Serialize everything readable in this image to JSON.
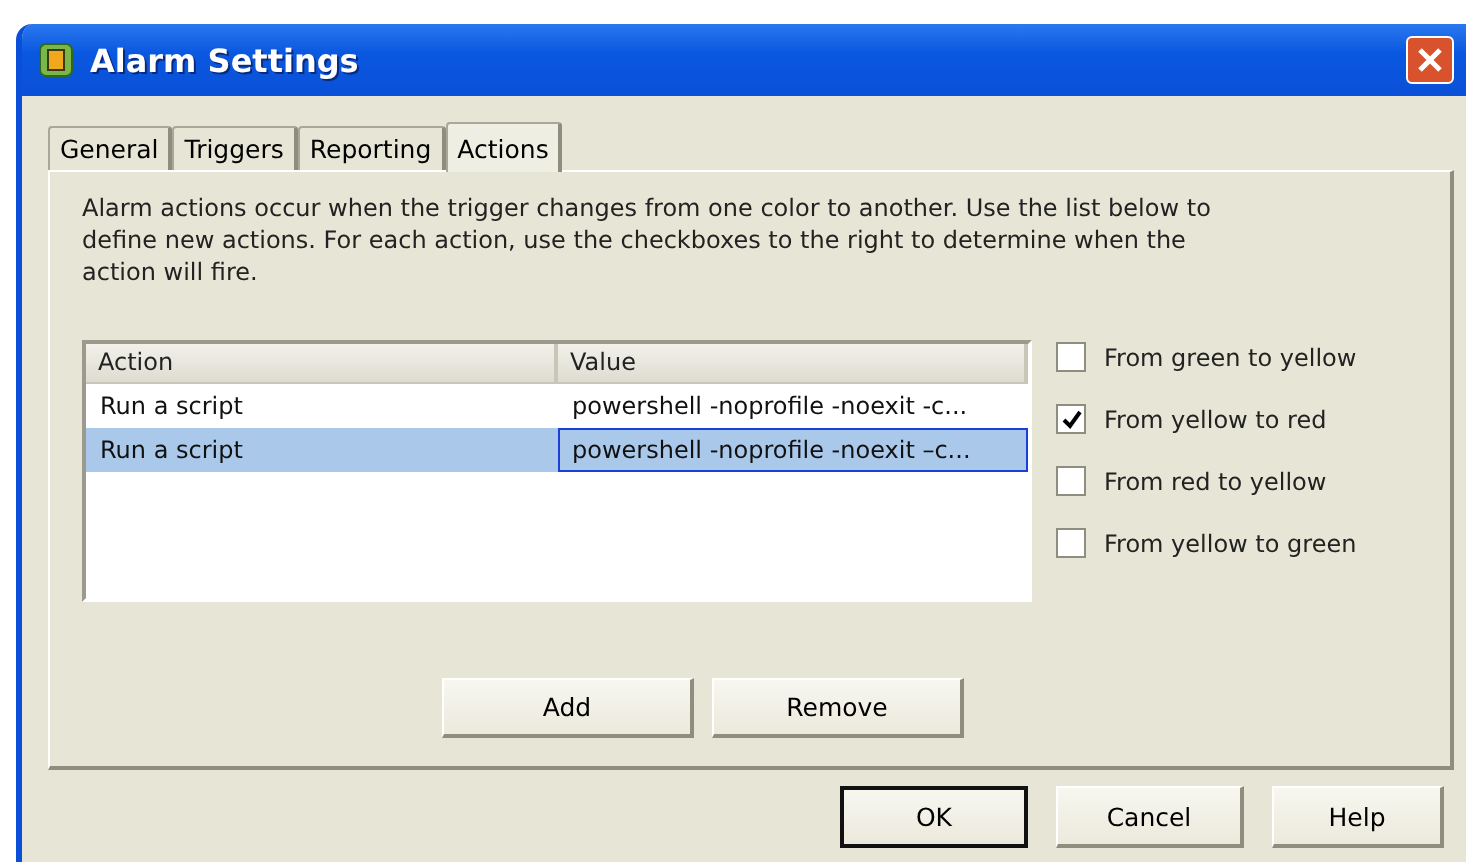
{
  "window": {
    "title": "Alarm Settings"
  },
  "tabs": [
    {
      "label": "General",
      "selected": false
    },
    {
      "label": "Triggers",
      "selected": false
    },
    {
      "label": "Reporting",
      "selected": false
    },
    {
      "label": "Actions",
      "selected": true
    }
  ],
  "description": "Alarm actions occur when the trigger changes from one color to another. Use the list below to define new actions. For each action, use the checkboxes to the right to determine when the action will fire.",
  "table": {
    "columns": [
      "Action",
      "Value"
    ],
    "rows": [
      {
        "cells": [
          "Run a script",
          "powershell -noprofile -noexit -c..."
        ],
        "selected": false
      },
      {
        "cells": [
          "Run a script",
          "powershell -noprofile -noexit –c..."
        ],
        "selected": true
      }
    ]
  },
  "transitions": [
    {
      "label": "From green to yellow",
      "checked": false
    },
    {
      "label": "From yellow to red",
      "checked": true
    },
    {
      "label": "From red to yellow",
      "checked": false
    },
    {
      "label": "From yellow to green",
      "checked": false
    }
  ],
  "list_buttons": [
    "Add",
    "Remove"
  ],
  "dialog_buttons": [
    {
      "label": "OK",
      "default": true
    },
    {
      "label": "Cancel",
      "default": false
    },
    {
      "label": "Help",
      "default": false
    }
  ]
}
